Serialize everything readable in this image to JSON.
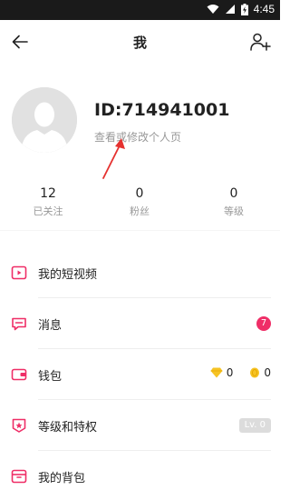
{
  "status_bar": {
    "time": "4:45"
  },
  "header": {
    "title": "我"
  },
  "profile": {
    "id_label": "ID:714941001",
    "edit_hint": "查看或修改个人页"
  },
  "stats": [
    {
      "value": "12",
      "label": "已关注"
    },
    {
      "value": "0",
      "label": "粉丝"
    },
    {
      "value": "0",
      "label": "等级"
    }
  ],
  "menu": {
    "videos": {
      "label": "我的短视频",
      "icon": "play-square-icon"
    },
    "messages": {
      "label": "消息",
      "icon": "chat-bubble-icon",
      "badge": "7"
    },
    "wallet": {
      "label": "钱包",
      "icon": "wallet-icon",
      "diamonds": "0",
      "coins": "0"
    },
    "level": {
      "label": "等级和特权",
      "icon": "star-shield-icon",
      "level_badge": "Lv. 0"
    },
    "bag": {
      "label": "我的背包",
      "icon": "backpack-icon"
    }
  },
  "colors": {
    "accent": "#ef2e67",
    "status_bar": "#1a1a1a",
    "muted_text": "#999999"
  }
}
